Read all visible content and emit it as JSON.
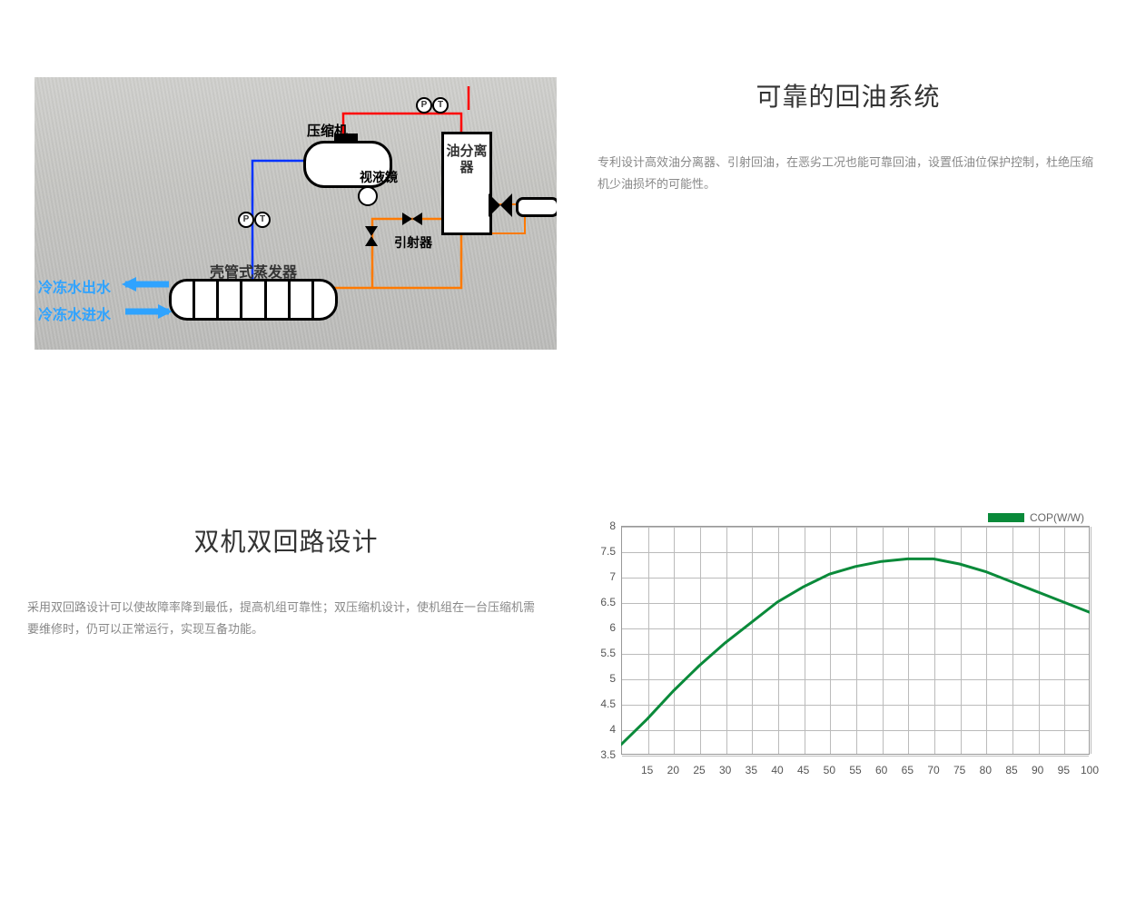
{
  "section1": {
    "title": "可靠的回油系统",
    "desc": "专利设计高效油分离器、引射回油，在恶劣工况也能可靠回油，设置低油位保护控制，杜绝压缩机少油损坏的可能性。",
    "diagram": {
      "compressor": "压缩机",
      "oil_separator": "油分离器",
      "sight_glass": "视液镜",
      "ejector": "引射器",
      "evaporator": "壳管式蒸发器",
      "chilled_water_out": "冷冻水出水",
      "chilled_water_in": "冷冻水进水",
      "gauge_p": "P",
      "gauge_t": "T"
    }
  },
  "section2": {
    "title": "双机双回路设计",
    "desc": "采用双回路设计可以使故障率降到最低，提高机组可靠性；双压缩机设计，使机组在一台压缩机需要维修时，仍可以正常运行，实现互备功能。"
  },
  "chart_data": {
    "type": "line",
    "title": "",
    "legend_label": "COP(W/W)",
    "xlabel": "",
    "ylabel": "",
    "ylim": [
      3.5,
      8
    ],
    "xlim": [
      10,
      100
    ],
    "y_ticks": [
      3.5,
      4,
      4.5,
      5,
      5.5,
      6,
      6.5,
      7,
      7.5,
      8
    ],
    "x_ticks": [
      15,
      20,
      25,
      30,
      35,
      40,
      45,
      50,
      55,
      60,
      65,
      70,
      75,
      80,
      85,
      90,
      95,
      100
    ],
    "series": [
      {
        "name": "COP(W/W)",
        "color": "#0a8a3a",
        "x": [
          10,
          15,
          20,
          25,
          30,
          35,
          40,
          45,
          50,
          55,
          60,
          65,
          70,
          75,
          80,
          85,
          90,
          95,
          100
        ],
        "values": [
          3.7,
          4.2,
          4.75,
          5.25,
          5.7,
          6.1,
          6.5,
          6.8,
          7.05,
          7.2,
          7.3,
          7.35,
          7.35,
          7.25,
          7.1,
          6.9,
          6.7,
          6.5,
          6.3
        ]
      }
    ]
  }
}
